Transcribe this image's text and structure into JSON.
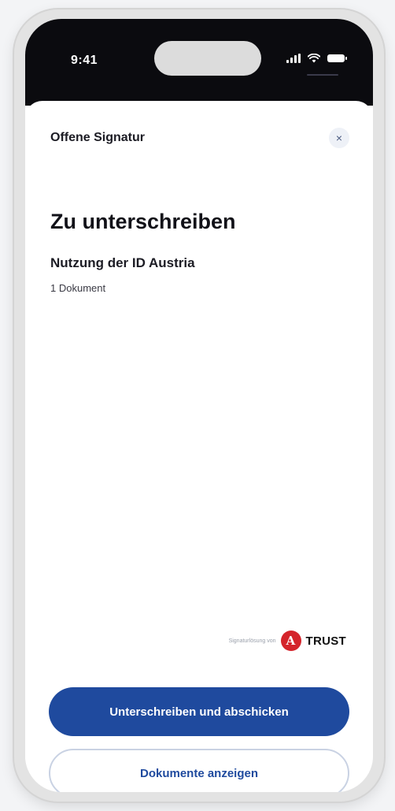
{
  "status_bar": {
    "time": "9:41",
    "icons": [
      "signal-icon",
      "wifi-icon",
      "battery-icon"
    ]
  },
  "sheet": {
    "title": "Offene Signatur",
    "close_icon": "×"
  },
  "content": {
    "heading": "Zu unterschreiben",
    "document_title": "Nutzung der ID Austria",
    "document_count": "1 Dokument"
  },
  "branding": {
    "caption": "Signaturlösung von",
    "logo_letter": "A",
    "logo_word": "TRUST",
    "logo_color": "#d4242b"
  },
  "actions": {
    "primary_label": "Unterschreiben und abschicken",
    "secondary_label": "Dokumente anzeigen"
  },
  "colors": {
    "accent": "#1f4a9e"
  }
}
